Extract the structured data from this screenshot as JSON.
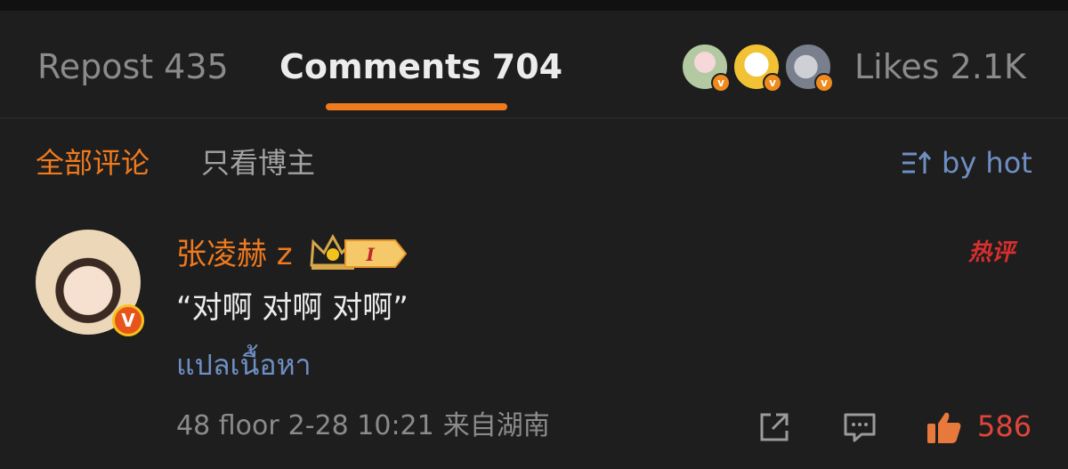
{
  "tabs": {
    "repost": {
      "label": "Repost",
      "count": "435"
    },
    "comments": {
      "label": "Comments",
      "count": "704"
    },
    "likes": {
      "label": "Likes",
      "count": "2.1K"
    }
  },
  "likers": [
    {
      "badge": "v"
    },
    {
      "badge": "v"
    },
    {
      "badge": "v"
    }
  ],
  "filters": {
    "all": "全部评论",
    "owner_only": "只看博主",
    "sort": "by hot",
    "sort_icon": "sort-icon"
  },
  "comment": {
    "username": "张凌赫 z",
    "level": "I",
    "verified_badge": "V",
    "hot_badge": "热评",
    "text": "“对啊 对啊 对啊”",
    "translate": "แปลเนื้อหา",
    "floor": "48 floor",
    "date": "2-28 10:21",
    "location": "来自湖南",
    "likes": "586"
  },
  "colors": {
    "background": "#1e1e1e",
    "accent": "#f07a1e",
    "link": "#6f8fc4",
    "like": "#e0453b"
  }
}
